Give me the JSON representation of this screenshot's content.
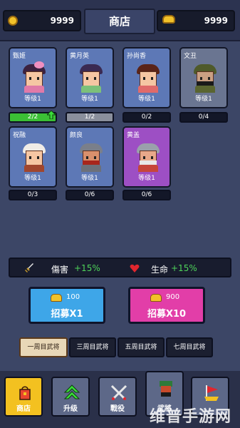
{
  "header": {
    "left_currency": "9999",
    "title": "商店",
    "right_currency": "9999"
  },
  "heroes": [
    {
      "name": "甄姬",
      "level": "等级1",
      "progress": "2/2"
    },
    {
      "name": "黄月英",
      "level": "等级1",
      "progress": "1/2"
    },
    {
      "name": "孙尚香",
      "level": "等级1",
      "progress": "0/2"
    },
    {
      "name": "文丑",
      "level": "等级1",
      "progress": "0/4"
    },
    {
      "name": "祝融",
      "level": "等级1",
      "progress": "0/3"
    },
    {
      "name": "颜良",
      "level": "等级1",
      "progress": "0/6"
    },
    {
      "name": "黄盖",
      "level": "等级1",
      "progress": "0/6"
    }
  ],
  "stats": {
    "damage_label": "傷害",
    "damage_value": "+15%",
    "life_label": "生命",
    "life_value": "+15%"
  },
  "recruit": {
    "x1_price": "100",
    "x1_label": "招募X1",
    "x10_price": "900",
    "x10_label": "招募X10"
  },
  "tabs": [
    "一周目武将",
    "三周目武将",
    "五周目武将",
    "七周目武将"
  ],
  "nav": [
    "商店",
    "升级",
    "戰役",
    "武將",
    ""
  ],
  "watermark": "维普手游网"
}
